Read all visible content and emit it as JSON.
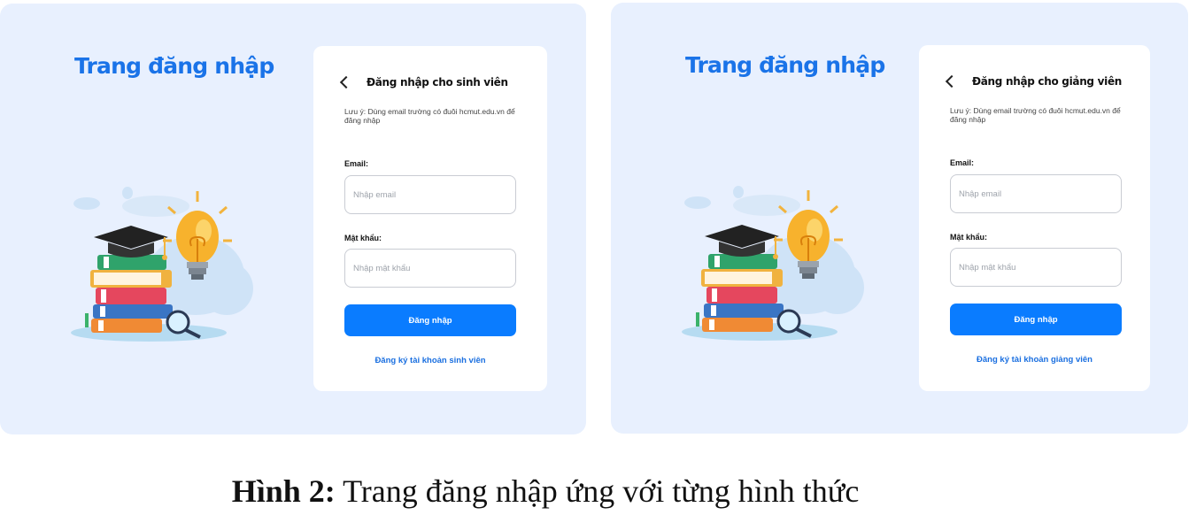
{
  "panels": [
    {
      "page_title": "Trang đăng nhập",
      "card_title": "Đăng nhập cho sinh viên",
      "note": "Lưu ý: Dùng email trường có đuôi hcmut.edu.vn để đăng nhập",
      "email_label": "Email:",
      "email_placeholder": "Nhập email",
      "password_label": "Mật khẩu:",
      "password_placeholder": "Nhập mật khẩu",
      "login_label": "Đăng nhập",
      "register_label": "Đăng ký tài khoản sinh viên"
    },
    {
      "page_title": "Trang đăng nhập",
      "card_title": "Đăng nhập cho giảng viên",
      "note": "Lưu ý: Dùng email trường có đuôi hcmut.edu.vn để đăng nhập",
      "email_label": "Email:",
      "email_placeholder": "Nhập email",
      "password_label": "Mật khẩu:",
      "password_placeholder": "Nhập mật khẩu",
      "login_label": "Đăng nhập",
      "register_label": "Đăng ký tài khoản giảng viên"
    }
  ],
  "caption": {
    "label": "Hình 2:",
    "text": " Trang đăng nhập ứng với từng hình thức"
  },
  "colors": {
    "panel_bg": "#e8f0fe",
    "accent": "#1a73e8",
    "button": "#0a7cff"
  },
  "icons": [
    "chevron-left-icon",
    "graduation-cap-icon",
    "books-icon",
    "lightbulb-icon",
    "magnifier-icon"
  ]
}
